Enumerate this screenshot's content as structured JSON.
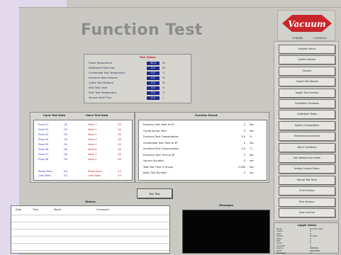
{
  "title": "Function Test",
  "logo": {
    "text": "Vacuum",
    "caption_left": "TURBINE",
    "caption_right": "CONTROLS"
  },
  "status_panel": {
    "header": "Test Status",
    "rows": [
      {
        "label": "Flame Temperature",
        "value": "40.0",
        "unit": "Pa"
      },
      {
        "label": "Defilement Plate Inlet",
        "value": "0.0",
        "unit": "Pa"
      },
      {
        "label": "Condensate Tank Temperature",
        "value": "0.0",
        "unit": "°C"
      },
      {
        "label": "Economic Tank Pressure",
        "value": "0.0",
        "unit": "Pa"
      },
      {
        "label": "Outlet Tank Pressure",
        "value": "0.0",
        "unit": "Pa"
      },
      {
        "label": "Inlet Tank Level",
        "value": "0.0",
        "unit": "%"
      },
      {
        "label": "Shell Tank Temperature",
        "value": "0.0",
        "unit": "°C"
      },
      {
        "label": "Vacuum Fault Time",
        "value": "0.0",
        "unit": "s"
      }
    ]
  },
  "input_tests": {
    "col1_header": "Input Test Data",
    "col2_header": "Valve Test Data",
    "left": [
      {
        "name": "Pulse 01",
        "val": "OK"
      },
      {
        "name": "Pulse 02",
        "val": "OK"
      },
      {
        "name": "Pulse 03",
        "val": "OK"
      },
      {
        "name": "Pulse 04",
        "val": "OK"
      },
      {
        "name": "Pulse 05",
        "val": "OK"
      },
      {
        "name": "Pulse 06",
        "val": "OK"
      },
      {
        "name": "Pulse 07",
        "val": "OK"
      },
      {
        "name": "Pulse 08",
        "val": "OK"
      }
    ],
    "right": [
      {
        "name": "Valve 1",
        "val": "OK"
      },
      {
        "name": "Valve 2",
        "val": "OK"
      },
      {
        "name": "Valve 3",
        "val": "OK"
      },
      {
        "name": "Valve 4",
        "val": "OK"
      },
      {
        "name": "Valve 5",
        "val": "OK"
      },
      {
        "name": "Valve 6",
        "val": "OK"
      },
      {
        "name": "Valve 7",
        "val": "OK"
      },
      {
        "name": "Valve 8",
        "val": "OK"
      }
    ],
    "footer_left": [
      {
        "name": "Result Data",
        "val": "0.0"
      },
      {
        "name": "Limit Data",
        "val": "0.0"
      }
    ],
    "footer_right": [
      {
        "name": "Result Data",
        "val": "0.0"
      },
      {
        "name": "Limit Data",
        "val": "0.0"
      }
    ]
  },
  "results": {
    "header": "Function Result",
    "rows": [
      {
        "label": "Economy Tank Start to 4P",
        "value": "0",
        "unit": "Sec"
      },
      {
        "label": "Condit Sensor Start",
        "value": "0",
        "unit": "Sec"
      },
      {
        "label": "Economy Tank Compensation",
        "value": "0.0",
        "unit": "%"
      },
      {
        "label": "Condensate Tank Time to 4P",
        "value": "0",
        "unit": "Sec"
      },
      {
        "label": "Accepted Tank Compensation",
        "value": "0.0",
        "unit": "°C"
      },
      {
        "label": "Economic Tank Time to 4P",
        "value": "0",
        "unit": "Sec"
      },
      {
        "label": "Vacuum Duration",
        "value": "0",
        "unit": "sec"
      },
      {
        "label": "Total Test Time (S Group)",
        "value": "0.000",
        "unit": "Sec"
      },
      {
        "label": "Boiler Test Duration",
        "value": "0",
        "unit": "sec"
      }
    ]
  },
  "run_button": "Run Test",
  "history": {
    "header": "History",
    "columns": [
      "Date",
      "Time",
      "Result",
      "Comments"
    ]
  },
  "messages": {
    "header": "Messages"
  },
  "logger": {
    "header": "Logger Status",
    "rows": [
      {
        "label": "Mode",
        "value": "Function Test"
      },
      {
        "label": "Status",
        "value": "0"
      },
      {
        "label": "Step",
        "value": "0"
      },
      {
        "label": "Result",
        "value": "Normal"
      },
      {
        "label": "Valve",
        "value": "0"
      },
      {
        "label": "Exit",
        "value": "0"
      },
      {
        "label": "Cycle",
        "value": "0"
      },
      {
        "label": "Tank Pos",
        "value": "0"
      },
      {
        "label": "Alarms",
        "value": "0000001"
      },
      {
        "label": "Fault",
        "value": "00000000"
      },
      {
        "label": "Messages",
        "value": "0"
      }
    ]
  },
  "nav": [
    "Program Status",
    "System Monitor",
    "Sensors",
    "Output Test Manual",
    "Logger Test Function",
    "Calibration Constants",
    "Calibration Tables",
    "System Configuration",
    "Maintenance Schedule",
    "Alarm Conditions",
    "VNC Network Run Mode",
    "Analog Outputs Status",
    "Manual Test Panel",
    "Print Screens",
    "Print Sections",
    "Save and Exit"
  ]
}
